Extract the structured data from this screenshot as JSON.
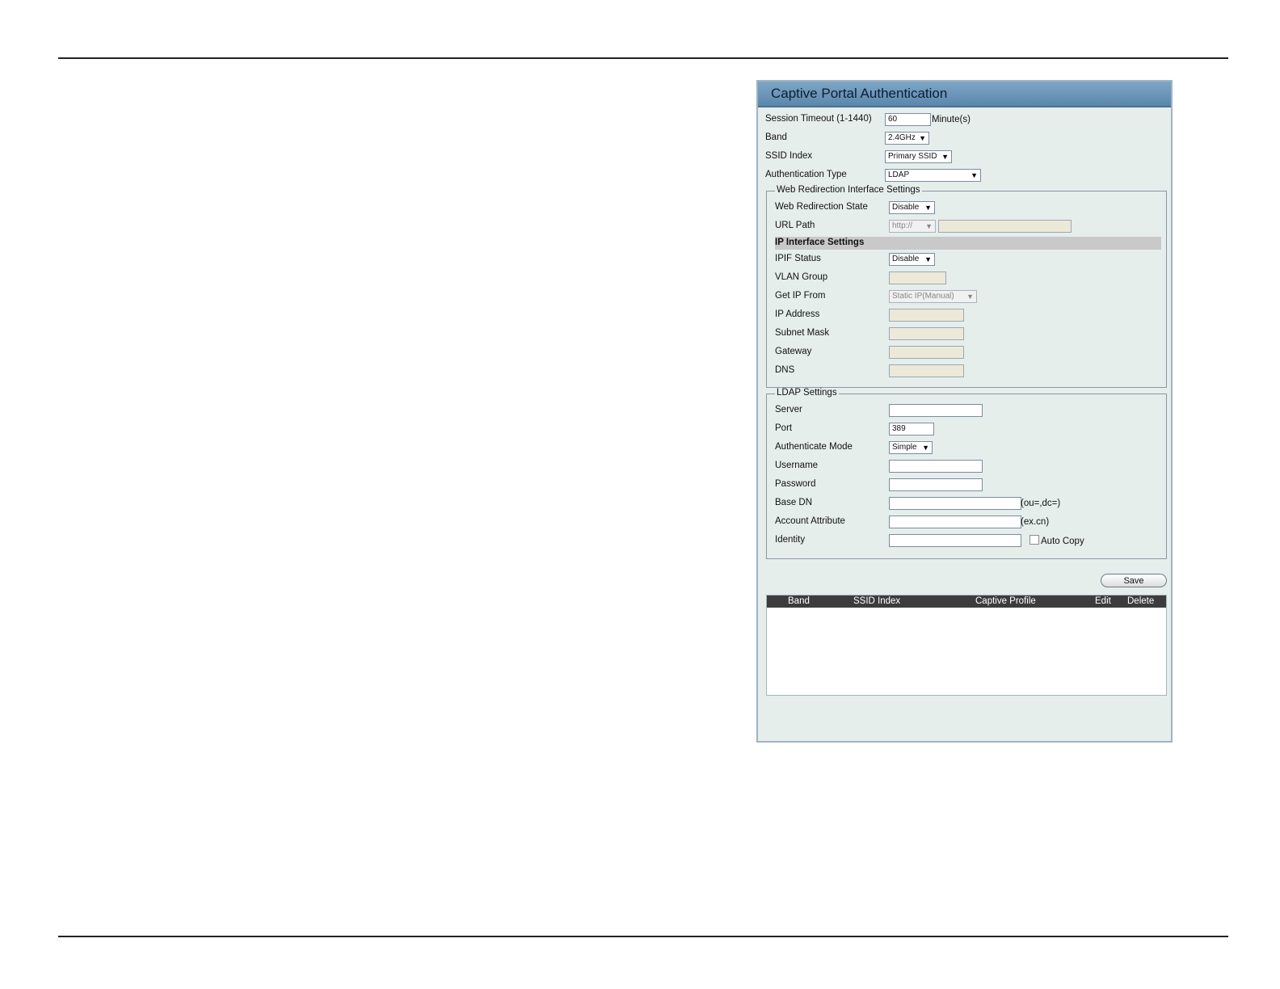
{
  "panel": {
    "title": "Captive Portal Authentication"
  },
  "form": {
    "session_timeout": {
      "label": "Session Timeout (1-1440)",
      "value": "60",
      "unit": "Minute(s)"
    },
    "band": {
      "label": "Band",
      "value": "2.4GHz"
    },
    "ssid_index": {
      "label": "SSID Index",
      "value": "Primary SSID"
    },
    "auth_type": {
      "label": "Authentication Type",
      "value": "LDAP"
    }
  },
  "web_redirection": {
    "legend": "Web Redirection Interface Settings",
    "state": {
      "label": "Web Redirection State",
      "value": "Disable"
    },
    "url_path": {
      "label": "URL Path",
      "value": "http://",
      "text": ""
    },
    "ip_interface_header": "IP Interface Settings",
    "ipif_status": {
      "label": "IPIF Status",
      "value": "Disable"
    },
    "vlan_group": {
      "label": "VLAN Group",
      "value": ""
    },
    "get_ip_from": {
      "label": "Get IP From",
      "value": "Static IP(Manual)"
    },
    "ip_address": {
      "label": "IP Address",
      "value": ""
    },
    "subnet_mask": {
      "label": "Subnet Mask",
      "value": ""
    },
    "gateway": {
      "label": "Gateway",
      "value": ""
    },
    "dns": {
      "label": "DNS",
      "value": ""
    }
  },
  "ldap": {
    "legend": "LDAP Settings",
    "server": {
      "label": "Server",
      "value": ""
    },
    "port": {
      "label": "Port",
      "value": "389"
    },
    "auth_mode": {
      "label": "Authenticate Mode",
      "value": "Simple"
    },
    "username": {
      "label": "Username",
      "value": ""
    },
    "password": {
      "label": "Password",
      "value": ""
    },
    "base_dn": {
      "label": "Base DN",
      "value": "",
      "hint": "(ou=,dc=)"
    },
    "account_attr": {
      "label": "Account Attribute",
      "value": "",
      "hint": "(ex.cn)"
    },
    "identity": {
      "label": "Identity",
      "value": "",
      "auto_copy": "Auto Copy",
      "auto_copy_checked": false
    }
  },
  "save_label": "Save",
  "table": {
    "headers": [
      "Band",
      "SSID Index",
      "Captive Profile",
      "Edit",
      "Delete"
    ],
    "rows": []
  }
}
